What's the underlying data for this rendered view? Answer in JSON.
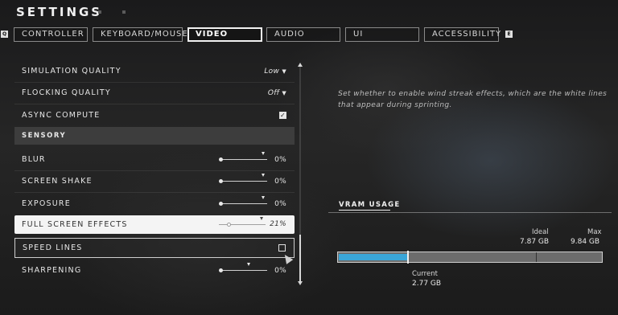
{
  "header": {
    "title": "SETTINGS",
    "left_bumper": "Q",
    "right_bumper": "E"
  },
  "tabs": [
    {
      "label": "CONTROLLER",
      "active": false
    },
    {
      "label": "KEYBOARD/MOUSE",
      "active": false
    },
    {
      "label": "VIDEO",
      "active": true
    },
    {
      "label": "AUDIO",
      "active": false
    },
    {
      "label": "UI",
      "active": false
    },
    {
      "label": "ACCESSIBILITY",
      "active": false
    }
  ],
  "settings": {
    "simulation_quality": {
      "label": "SIMULATION QUALITY",
      "value": "Low"
    },
    "flocking_quality": {
      "label": "FLOCKING QUALITY",
      "value": "Off"
    },
    "async_compute": {
      "label": "ASYNC COMPUTE",
      "checked": true
    },
    "sensory_section": "SENSORY",
    "blur": {
      "label": "BLUR",
      "value": "0%",
      "level": 0
    },
    "screen_shake": {
      "label": "SCREEN SHAKE",
      "value": "0%",
      "level": 0
    },
    "exposure": {
      "label": "EXPOSURE",
      "value": "0%",
      "level": 0
    },
    "full_screen_effects": {
      "label": "FULL SCREEN EFFECTS",
      "value": "21%",
      "level": 0.21
    },
    "speed_lines": {
      "label": "SPEED LINES",
      "checked": false
    },
    "sharpening": {
      "label": "SHARPENING",
      "value": "0%",
      "level": 0
    }
  },
  "description": "Set whether to enable wind streak effects, which are the white lines that appear during sprinting.",
  "vram": {
    "title": "VRAM USAGE",
    "ideal_label": "Ideal",
    "ideal_value": "7.87 GB",
    "max_label": "Max",
    "max_value": "9.84 GB",
    "current_label": "Current",
    "current_value": "2.77 GB",
    "current_gb": 2.77,
    "ideal_gb": 7.87,
    "max_gb": 9.84
  },
  "colors": {
    "accent": "#3aa6d8",
    "highlight_row": "#f4f4f4"
  }
}
